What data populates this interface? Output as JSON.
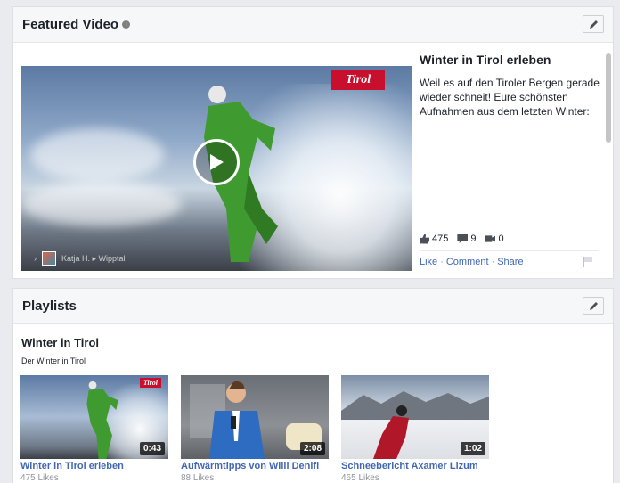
{
  "featured": {
    "header": "Featured Video",
    "video": {
      "title": "Winter in Tirol erleben",
      "description": "Weil es auf den Tiroler Bergen gerade wieder schneit! Eure schönsten Aufnahmen aus dem letzten Winter:",
      "logo_text": "Tirol",
      "attribution": "Katja H. ▸ Wipptal",
      "likes": "475",
      "comments": "9",
      "shares": "0"
    },
    "actions": {
      "like": "Like",
      "comment": "Comment",
      "share": "Share",
      "sep": "·"
    }
  },
  "playlists": {
    "header": "Playlists",
    "title": "Winter in Tirol",
    "subtitle": "Der Winter in Tirol",
    "items": [
      {
        "title": "Winter in Tirol erleben",
        "likes": "475 Likes",
        "duration": "0:43",
        "badge": "Tirol"
      },
      {
        "title": "Aufwärmtipps von Willi Denifl",
        "likes": "88 Likes",
        "duration": "2:08"
      },
      {
        "title": "Schneebericht Axamer Lizum",
        "likes": "465 Likes",
        "duration": "1:02"
      }
    ]
  },
  "colors": {
    "link": "#4267b2",
    "brand_red": "#c8102e",
    "header_bg": "#f6f7f9"
  }
}
